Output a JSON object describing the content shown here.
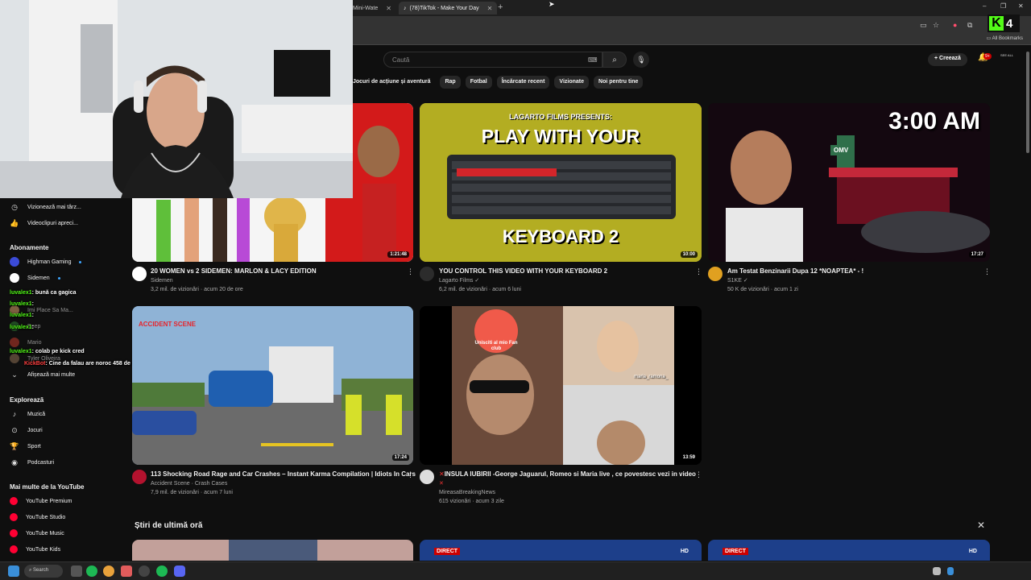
{
  "browser": {
    "tabs": [
      {
        "label": "Mini-Wate",
        "active": false
      },
      {
        "label": "(78)TikTok - Make Your Day",
        "active": true
      }
    ],
    "all_bookmarks": "All Bookmarks",
    "kick_badge_count": "4"
  },
  "header": {
    "search_placeholder": "Caută",
    "create_label": "Creează",
    "notification_count": "9+",
    "avatar_text": "SEE ALL"
  },
  "chips": [
    "Jocuri de acțiune și aventură",
    "Rap",
    "Fotbal",
    "Încărcate recent",
    "Vizionate",
    "Noi pentru tine"
  ],
  "sidebar": {
    "you_items": [
      {
        "label": "Vizionează mai târz...",
        "icon": "clock-icon"
      },
      {
        "label": "Videoclipuri apreci...",
        "icon": "thumbs-up-icon"
      }
    ],
    "subs_title": "Abonamente",
    "subscriptions": [
      {
        "label": "Highman Gaming",
        "color": "#3b4bd8"
      },
      {
        "label": "Sidemen",
        "color": "#ffffff"
      },
      {
        "label": "Imi Place Sa Ma...",
        "color": "#d6a06b"
      },
      {
        "label": "Beep",
        "color": "#2e7d32"
      },
      {
        "label": "Mario",
        "color": "#c0392b"
      },
      {
        "label": "Tyler Oliveira",
        "color": "#8e6e53"
      }
    ],
    "show_more": "Afișează mai multe",
    "explore_title": "Explorează",
    "explore_items": [
      {
        "label": "Muzică",
        "icon": "music-icon"
      },
      {
        "label": "Jocuri",
        "icon": "gamepad-icon"
      },
      {
        "label": "Sport",
        "icon": "trophy-icon"
      },
      {
        "label": "Podcasturi",
        "icon": "podcast-icon"
      }
    ],
    "more_title": "Mai multe de la YouTube",
    "more_items": [
      "YouTube Premium",
      "YouTube Studio",
      "YouTube Music",
      "YouTube Kids"
    ]
  },
  "chat": [
    {
      "user": "luvalex1",
      "text": ": bună ca gagica"
    },
    {
      "user": "luvalex1",
      "text": ":"
    },
    {
      "user": "luvalex1",
      "text": ":"
    },
    {
      "user": "luvalex1",
      "text": ":"
    },
    {
      "user": "luvalex1",
      "text": ": colab pe kick cred"
    },
    {
      "user": "KickBot",
      "text": ": Cine da falau are noroc 458 de ani lumina <3"
    }
  ],
  "videos": [
    {
      "title": "20 WOMEN vs 2 SIDEMEN: MARLON & LACY EDITION",
      "channel": "Sidemen",
      "stats": "3,2 mil. de vizionări · acum 20 de ore",
      "duration": "1:21:48"
    },
    {
      "title": "YOU CONTROL THIS VIDEO WITH YOUR KEYBOARD 2",
      "channel": "Lagarto Films",
      "stats": "6,2 mil. de vizionări · acum 6 luni",
      "duration": "10:00",
      "thumb_top": "LAGARTO FILMS PRESENTS:",
      "thumb_mid": "PLAY WITH YOUR",
      "thumb_bottom": "KEYBOARD 2"
    },
    {
      "title": "Am Testat Benzinarii Dupa 12 *NOAPTEA* - !",
      "channel": "S1KE",
      "stats": "50 K de vizionări · acum 1 zi",
      "duration": "17:27",
      "thumb_text": "3:00 AM",
      "sign": "OMV"
    },
    {
      "title": "113 Shocking Road Rage and Car Crashes – Instant Karma Compilation | Idiots In Cars",
      "channel": "Accident Scene · Crash Cases",
      "stats": "7,9 mil. de vizionări · acum 7 luni",
      "duration": "17:24",
      "thumb_tag": "ACCIDENT SCENE"
    },
    {
      "title": "INSULA IUBIRII -George Jaguarul, Romeo si Maria live , ce povestesc vezi in video",
      "channel": "MireasaBreakingNews",
      "stats": "615 vizionări · acum 3 zile",
      "duration": "13:59",
      "overlay": "Unisciti al mio Fan club",
      "name_tag": "maria_ramona_"
    }
  ],
  "news": {
    "title": "Știri de ultimă oră",
    "direct_label": "DIRECT",
    "hd_label": "HD"
  },
  "taskbar": {
    "search_label": "Search"
  }
}
